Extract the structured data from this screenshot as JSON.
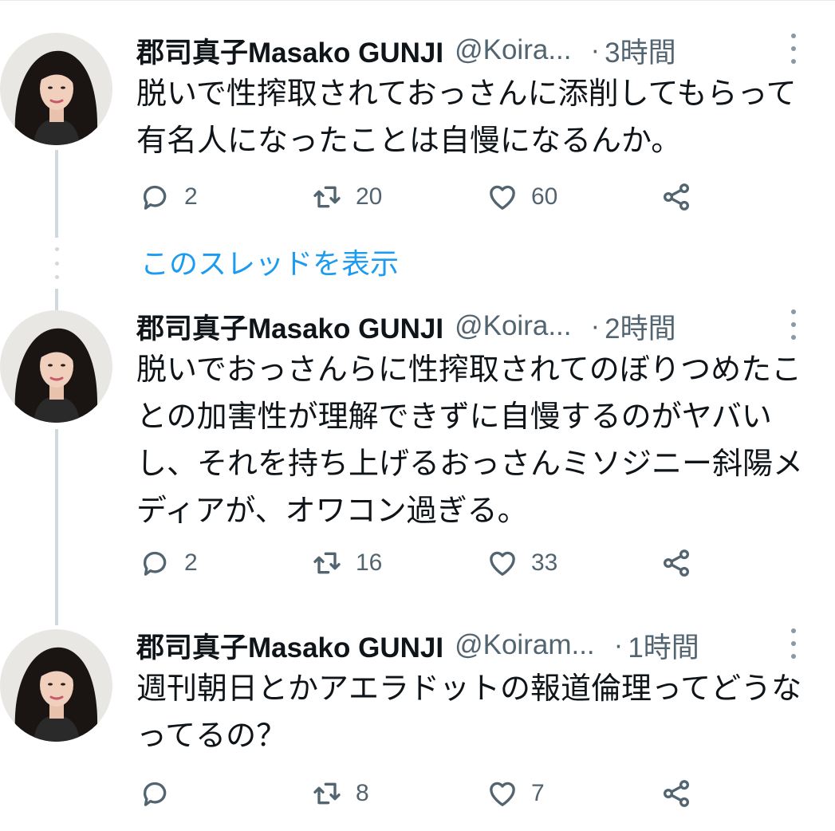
{
  "tweets": [
    {
      "name": "郡司真子Masako GUNJI",
      "handle": "@Koira...",
      "dot": "·",
      "time": "3時間",
      "text": "脱いで性搾取されておっさんに添削してもらって有名人になったことは自慢になるんか。",
      "replies": "2",
      "retweets": "20",
      "likes": "60"
    },
    {
      "name": "郡司真子Masako GUNJI",
      "handle": "@Koira...",
      "dot": "·",
      "time": "2時間",
      "text": "脱いでおっさんらに性搾取されてのぼりつめたことの加害性が理解できずに自慢するのがヤバいし、それを持ち上げるおっさんミソジニー斜陽メディアが、オワコン過ぎる。",
      "replies": "2",
      "retweets": "16",
      "likes": "33"
    },
    {
      "name": "郡司真子Masako GUNJI",
      "handle": "@Koiram...",
      "dot": "·",
      "time": "1時間",
      "text": "週刊朝日とかアエラドットの報道倫理ってどうなってるの？",
      "replies": "",
      "retweets": "8",
      "likes": "7"
    }
  ],
  "show_thread": "このスレッドを表示",
  "icons": [
    "reply-icon",
    "retweet-icon",
    "like-icon",
    "share-icon",
    "more-icon"
  ],
  "colors": {
    "link": "#1d9bf0",
    "secondary_text": "#536471",
    "thread_line": "#cfd9de"
  }
}
